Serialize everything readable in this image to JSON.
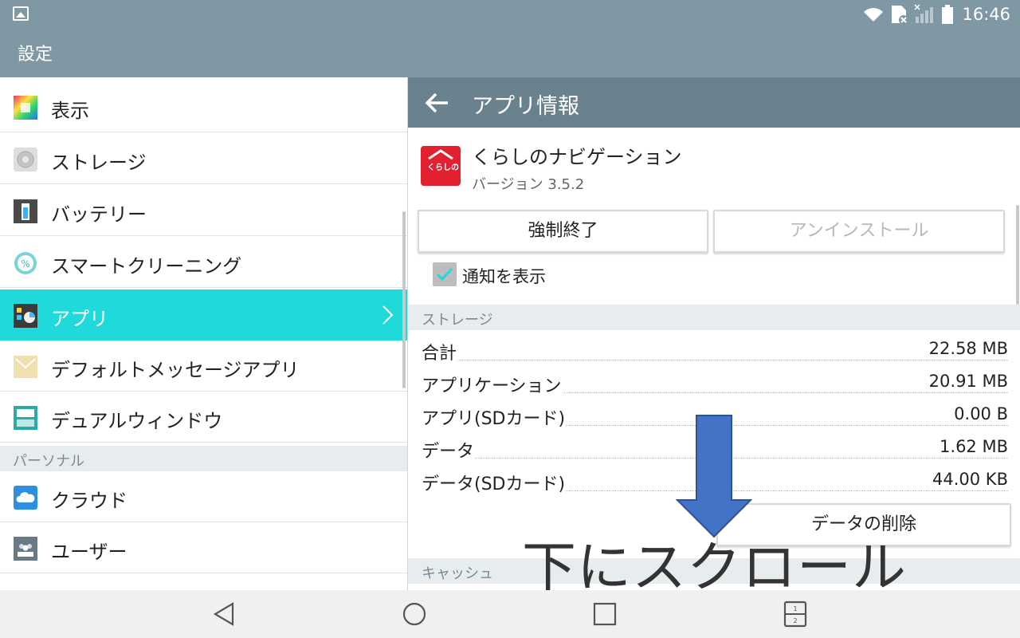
{
  "status_bar": {
    "time": "16:46"
  },
  "title_bar": {
    "title": "設定"
  },
  "left_menu": {
    "items_top": [
      {
        "label": "表示",
        "icon": "display-icon"
      },
      {
        "label": "ストレージ",
        "icon": "storage-icon"
      },
      {
        "label": "バッテリー",
        "icon": "battery-icon"
      },
      {
        "label": "スマートクリーニング",
        "icon": "smart-cleaning-icon"
      },
      {
        "label": "アプリ",
        "icon": "apps-icon",
        "active": true
      },
      {
        "label": "デフォルトメッセージアプリ",
        "icon": "message-icon"
      },
      {
        "label": "デュアルウィンドウ",
        "icon": "dual-window-icon"
      }
    ],
    "section_personal": "パーソナル",
    "items_personal": [
      {
        "label": "クラウド",
        "icon": "cloud-icon"
      },
      {
        "label": "ユーザー",
        "icon": "users-icon"
      }
    ]
  },
  "app_info": {
    "header_title": "アプリ情報",
    "app_name": "くらしのナビゲーション",
    "version": "バージョン 3.5.2",
    "icon_text": "くらしの",
    "force_stop": "強制終了",
    "uninstall": "アンインストール",
    "show_notifications": "通知を表示",
    "storage_section": "ストレージ",
    "storage_rows": [
      {
        "label": "合計",
        "value": "22.58 MB"
      },
      {
        "label": "アプリケーション",
        "value": "20.91 MB"
      },
      {
        "label": "アプリ(SDカード)",
        "value": "0.00 B"
      },
      {
        "label": "データ",
        "value": "1.62 MB"
      },
      {
        "label": "データ(SDカード)",
        "value": "44.00 KB"
      }
    ],
    "clear_data": "データの削除",
    "cache_section": "キャッシュ"
  },
  "overlay": {
    "text": "下にスクロール",
    "arrow_color": "#4472c4"
  },
  "colors": {
    "active": "#1fd9db",
    "header": "#6a828e",
    "statusbar": "#7f98a4"
  }
}
